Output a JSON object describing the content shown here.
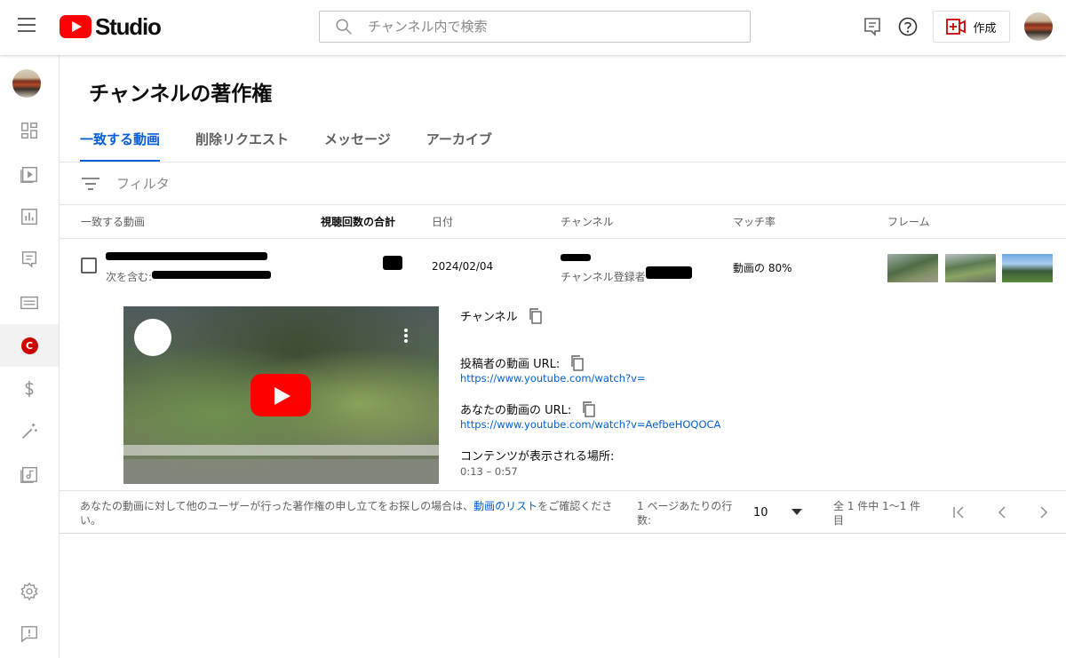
{
  "header": {
    "logo_text": "Studio",
    "search_placeholder": "チャンネル内で検索",
    "create_label": "作成"
  },
  "page": {
    "title": "チャンネルの著作権",
    "tabs": [
      {
        "label": "一致する動画",
        "active": true
      },
      {
        "label": "削除リクエスト"
      },
      {
        "label": "メッセージ"
      },
      {
        "label": "アーカイブ"
      }
    ],
    "filter_label": "フィルタ"
  },
  "table": {
    "headers": {
      "video": "一致する動画",
      "views": "視聴回数の合計",
      "date": "日付",
      "channel": "チャンネル",
      "match": "マッチ率",
      "frames": "フレーム"
    },
    "row": {
      "video_subtitle": "次を含む:",
      "date": "2024/02/04",
      "channel_subtitle": "チャンネル登録者",
      "match": "動画の 80%"
    }
  },
  "details": {
    "channel_label": "チャンネル",
    "uploader_url_label": "投稿者の動画 URL:",
    "uploader_url": "https://www.youtube.com/watch?v=",
    "your_url_label": "あなたの動画の URL:",
    "your_url": "https://www.youtube.com/watch?v=AefbeHOQOCA",
    "location_label": "コンテンツが表示される場所:",
    "time_range": "0:13 – 0:57"
  },
  "footer": {
    "text_before": "あなたの動画に対して他のユーザーが行った著作権の申し立てをお探しの場合は、",
    "link": "動画のリスト",
    "text_after": "をご確認ください。",
    "rows_label": "1 ページあたりの行数:",
    "rows_value": "10",
    "range": "全 1 件中 1〜1 件目"
  },
  "colors": {
    "accent": "#065fd4",
    "brand_red": "#ff0000"
  }
}
